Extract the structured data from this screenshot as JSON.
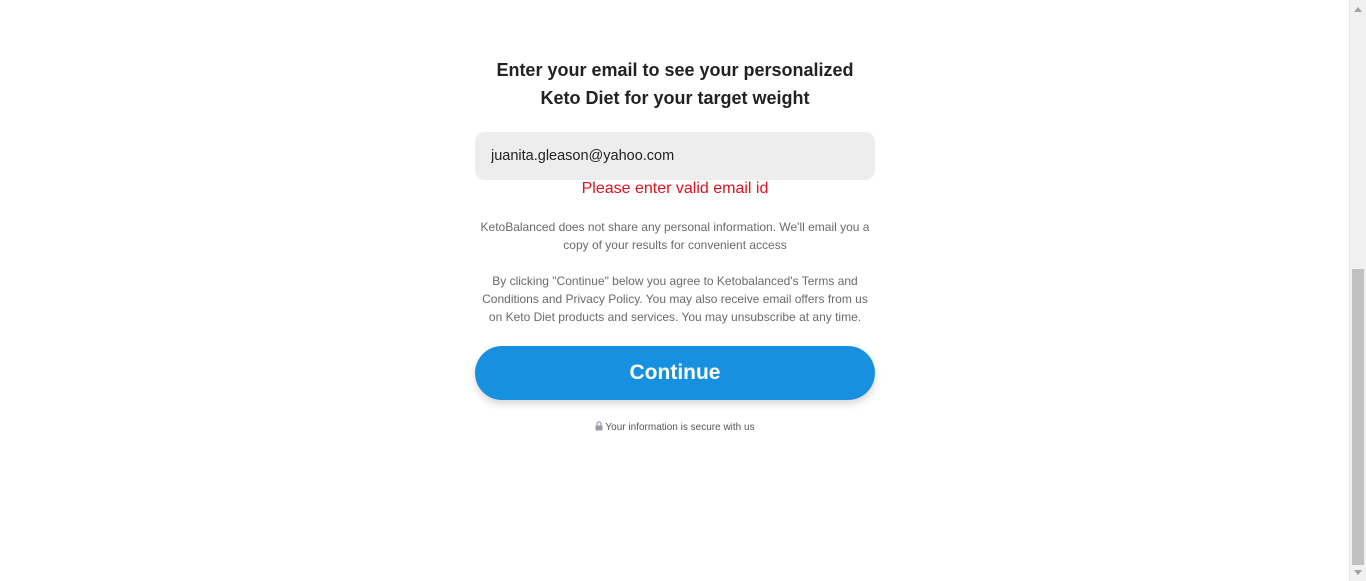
{
  "form": {
    "heading_line1": "Enter your email to see your personalized",
    "heading_line2": "Keto Diet for your target weight",
    "email_value": "juanita.gleason@yahoo.com",
    "error_message": "Please enter valid email id",
    "privacy_note": "KetoBalanced does not share any personal information. We'll email you a copy of your results for convenient access",
    "consent_note": "By clicking \"Continue\" below you agree to Ketobalanced's Terms and Conditions and Privacy Policy. You may also receive email offers from us on Keto Diet products and services. You may unsubscribe at any time.",
    "continue_label": "Continue",
    "secure_text": "Your information is secure with us",
    "secure_icon": "lock-icon"
  },
  "colors": {
    "button": "#1890e0",
    "error": "#e0121b",
    "input_bg": "#ededed"
  }
}
